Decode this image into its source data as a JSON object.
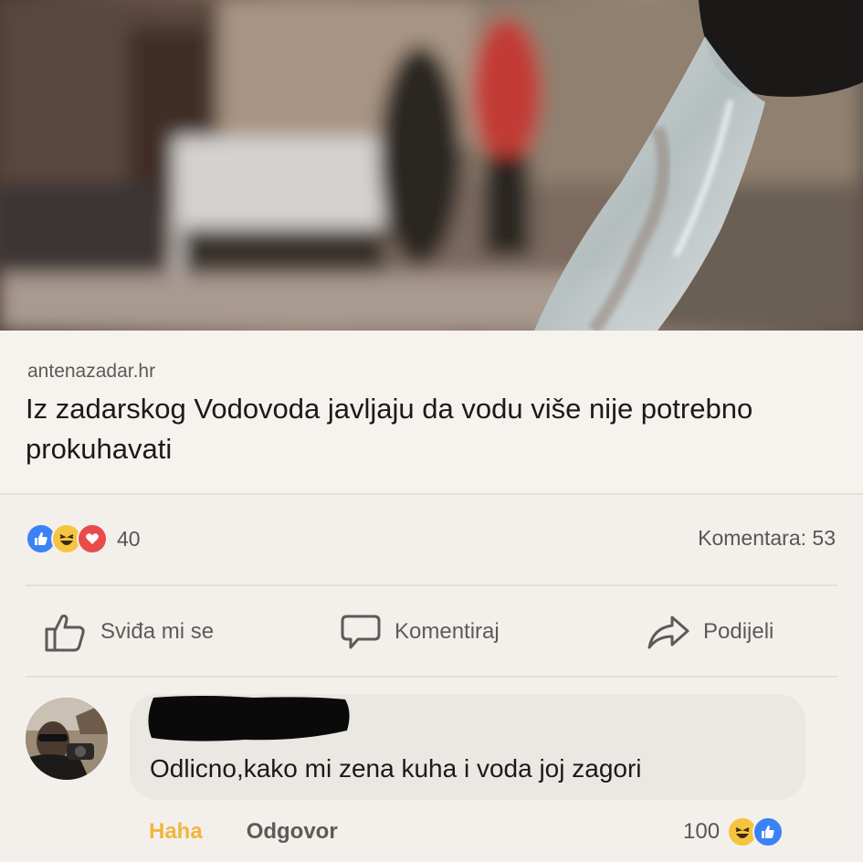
{
  "post": {
    "link_domain": "antenazadar.hr",
    "headline": "Iz zadarskog Vodovoda javljaju da vodu više nije potrebno prokuhavati",
    "reactions": {
      "icons": [
        "like-icon",
        "haha-icon",
        "love-icon"
      ],
      "count": "40"
    },
    "comments_count": "Komentara: 53"
  },
  "actions": {
    "like": "Sviđa mi se",
    "comment": "Komentiraj",
    "share": "Podijeli"
  },
  "comment": {
    "text": "Odlicno,kako mi zena kuha i voda joj zagori",
    "reaction_label": "Haha",
    "reply_label": "Odgovor",
    "reaction_count": "100",
    "reaction_icons": [
      "haha-icon",
      "like-icon"
    ]
  },
  "colors": {
    "like_blue": "#3b82f6",
    "haha_yellow": "#f7c43f",
    "love_red": "#e94b4b",
    "haha_text": "#f1b63c"
  }
}
